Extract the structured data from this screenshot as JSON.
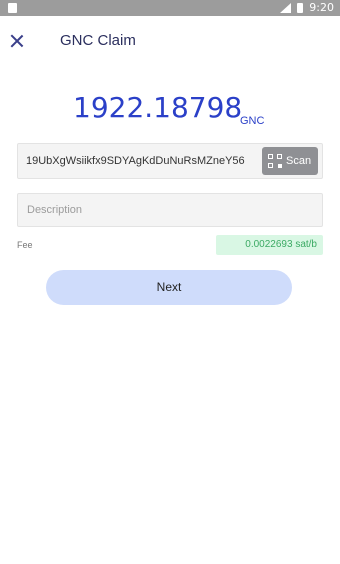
{
  "status_bar": {
    "time": "9:20"
  },
  "header": {
    "title": "GNC Claim"
  },
  "balance": {
    "amount": "1922.18798",
    "unit": "GNC"
  },
  "address": {
    "value": "19UbXgWsiikfx9SDYAgKdDuNuRsMZneY56",
    "scan_label": "Scan"
  },
  "description": {
    "placeholder": "Description",
    "value": ""
  },
  "fee": {
    "label": "Fee",
    "value": "0.0022693 sat/b"
  },
  "next_button": {
    "label": "Next"
  }
}
